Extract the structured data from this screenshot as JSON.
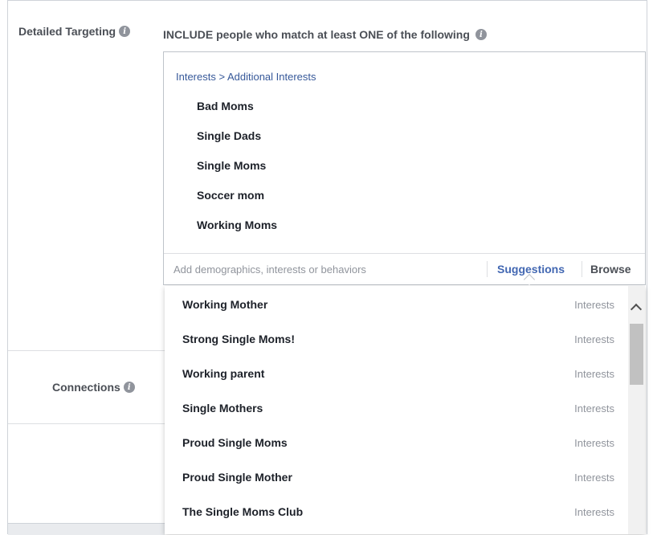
{
  "targeting": {
    "label": "Detailed Targeting",
    "include_text": "INCLUDE people who match at least ONE of the following",
    "breadcrumb": "Interests > Additional Interests",
    "selected": [
      "Bad Moms",
      "Single Dads",
      "Single Moms",
      "Soccer mom",
      "Working Moms"
    ],
    "search_placeholder": "Add demographics, interests or behaviors",
    "tabs": {
      "suggestions": "Suggestions",
      "browse": "Browse"
    }
  },
  "connections": {
    "label": "Connections"
  },
  "suggestions": [
    {
      "name": "Working Mother",
      "category": "Interests"
    },
    {
      "name": "Strong Single Moms!",
      "category": "Interests"
    },
    {
      "name": "Working parent",
      "category": "Interests"
    },
    {
      "name": "Single Mothers",
      "category": "Interests"
    },
    {
      "name": "Proud Single Moms",
      "category": "Interests"
    },
    {
      "name": "Proud Single Mother",
      "category": "Interests"
    },
    {
      "name": "The Single Moms Club",
      "category": "Interests"
    }
  ],
  "icons": {
    "info": "info-icon",
    "scroll_up": "chevron-up-icon"
  },
  "colors": {
    "link": "#365899",
    "accent": "#4267b2",
    "muted": "#90949c"
  }
}
